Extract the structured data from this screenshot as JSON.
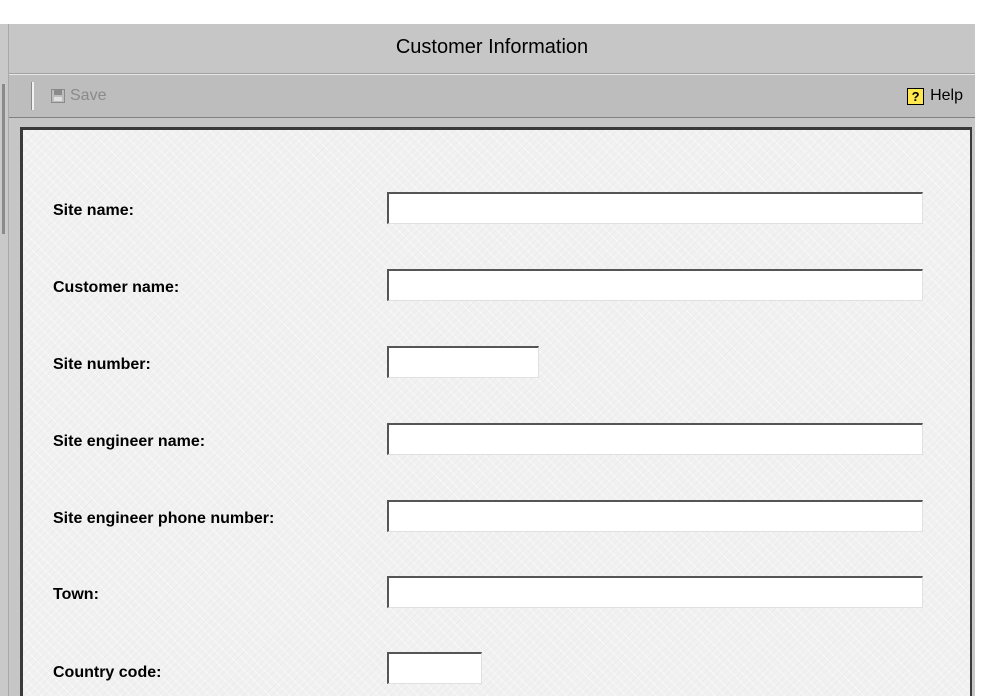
{
  "window": {
    "title": "Customer Information"
  },
  "toolbar": {
    "save_label": "Save",
    "save_icon": "floppy-disk-icon",
    "help_label": "Help",
    "help_icon": "question-mark-icon"
  },
  "form": {
    "fields": [
      {
        "label": "Site name:",
        "value": ""
      },
      {
        "label": "Customer name:",
        "value": ""
      },
      {
        "label": "Site number:",
        "value": ""
      },
      {
        "label": "Site engineer name:",
        "value": ""
      },
      {
        "label": "Site engineer phone number:",
        "value": ""
      },
      {
        "label": "Town:",
        "value": ""
      },
      {
        "label": "Country code:",
        "value": ""
      }
    ]
  },
  "colors": {
    "title_bar": "#c6c6c6",
    "toolbar": "#bdbdbd",
    "panel": "#f1f1f1",
    "panel_border": "#3a3a3a",
    "help_icon": "#ffe84d"
  }
}
